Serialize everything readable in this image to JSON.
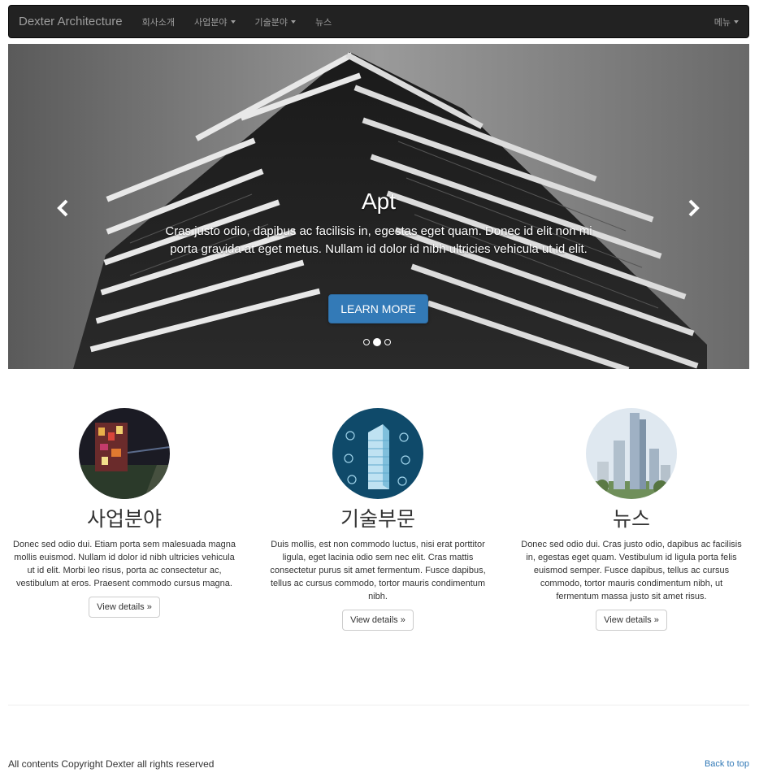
{
  "navbar": {
    "brand": "Dexter Architecture",
    "items": [
      {
        "label": "회사소개",
        "dropdown": false
      },
      {
        "label": "사업분야",
        "dropdown": true
      },
      {
        "label": "기술분야",
        "dropdown": true
      },
      {
        "label": "뉴스",
        "dropdown": false
      }
    ],
    "right_menu": "메뉴"
  },
  "carousel": {
    "title": "Apt",
    "text": "Cras justo odio, dapibus ac facilisis in, egestas eget quam. Donec id elit non mi porta gravida at eget metus. Nullam id dolor id nibh ultricies vehicula ut id elit.",
    "button": "LEARN MORE",
    "slides": 3,
    "active_slide": 2
  },
  "features": [
    {
      "heading": "사업분야",
      "text": "Donec sed odio dui. Etiam porta sem malesuada magna mollis euismod. Nullam id dolor id nibh ultricies vehicula ut id elit. Morbi leo risus, porta ac consectetur ac, vestibulum at eros. Praesent commodo cursus magna.",
      "button": "View details »"
    },
    {
      "heading": "기술부문",
      "text": "Duis mollis, est non commodo luctus, nisi erat porttitor ligula, eget lacinia odio sem nec elit. Cras mattis consectetur purus sit amet fermentum. Fusce dapibus, tellus ac cursus commodo, tortor mauris condimentum nibh.",
      "button": "View details »"
    },
    {
      "heading": "뉴스",
      "text": "Donec sed odio dui. Cras justo odio, dapibus ac facilisis in, egestas eget quam. Vestibulum id ligula porta felis euismod semper. Fusce dapibus, tellus ac cursus commodo, tortor mauris condimentum nibh, ut fermentum massa justo sit amet risus.",
      "button": "View details »"
    }
  ],
  "footer": {
    "copyright": "All contents Copyright Dexter all rights reserved",
    "back_to_top": "Back to top"
  },
  "colors": {
    "navbar_bg": "#222222",
    "primary": "#337ab7"
  }
}
